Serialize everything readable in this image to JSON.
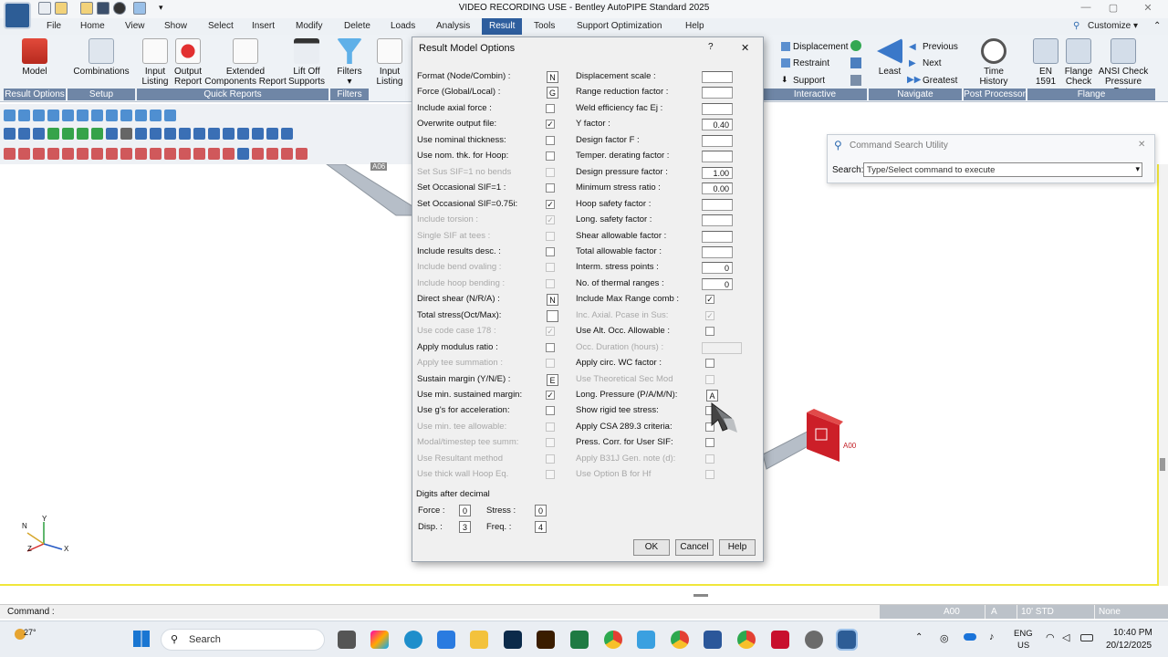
{
  "app": {
    "title": "VIDEO RECORDING USE - Bentley AutoPIPE Standard 2025",
    "customize": "Customize"
  },
  "menu": [
    "File",
    "Home",
    "View",
    "Show",
    "Select",
    "Insert",
    "Modify",
    "Delete",
    "Loads",
    "Analysis",
    "Result",
    "Tools",
    "Support Optimization",
    "Help"
  ],
  "ribbon": {
    "model": "Model",
    "combinations": "Combinations",
    "input_listing": "Input Listing",
    "output_report": "Output Report",
    "extended_report": "Extended Components Report",
    "lift_off": "Lift Off Supports",
    "filters": "Filters",
    "input_listing2": "Input Listing",
    "displacement": "Displacement",
    "restraint": "Restraint",
    "support": "Support",
    "least": "Least",
    "previous": "Previous",
    "next": "Next",
    "greatest": "Greatest",
    "time_history": "Time History",
    "en1591": "EN 1591",
    "flange_check": "Flange Check",
    "ansi_check": "ANSI Check Pressure Data",
    "groups": {
      "result_options": "Result Options",
      "setup": "Setup",
      "quick_reports": "Quick Reports",
      "filters": "Filters",
      "interactive": "Interactive",
      "navigate": "Navigate",
      "post_processor": "Post Processor",
      "flange": "Flange"
    }
  },
  "dialog": {
    "title": "Result Model Options",
    "help_glyph": "?",
    "close_glyph": "✕",
    "left_options": [
      {
        "label": "Format (Node/Combin) :",
        "ctrl": "sel",
        "value": "N",
        "disabled": false
      },
      {
        "label": "Force (Global/Local) :",
        "ctrl": "sel",
        "value": "G",
        "disabled": false
      },
      {
        "label": "Include axial force :",
        "ctrl": "chk",
        "value": "",
        "disabled": false
      },
      {
        "label": "Overwrite output file:",
        "ctrl": "chk",
        "value": "✓",
        "disabled": false
      },
      {
        "label": "Use nominal thickness:",
        "ctrl": "chk",
        "value": "",
        "disabled": false
      },
      {
        "label": "Use nom. thk. for Hoop:",
        "ctrl": "chk",
        "value": "",
        "disabled": false
      },
      {
        "label": "Set Sus SIF=1 no bends",
        "ctrl": "chk",
        "value": "",
        "disabled": true
      },
      {
        "label": "Set Occasional SIF=1 :",
        "ctrl": "chk",
        "value": "",
        "disabled": false
      },
      {
        "label": "Set Occasional SIF=0.75i:",
        "ctrl": "chk",
        "value": "✓",
        "disabled": false
      },
      {
        "label": "Include torsion :",
        "ctrl": "chk",
        "value": "✓",
        "disabled": true
      },
      {
        "label": "Single SIF at tees :",
        "ctrl": "chk",
        "value": "",
        "disabled": true
      },
      {
        "label": "Include results desc. :",
        "ctrl": "chk",
        "value": "",
        "disabled": false
      },
      {
        "label": "Include bend ovaling :",
        "ctrl": "chk",
        "value": "",
        "disabled": true
      },
      {
        "label": "Include hoop bending :",
        "ctrl": "chk",
        "value": "",
        "disabled": true
      },
      {
        "label": "Direct shear (N/R/A) :",
        "ctrl": "sel",
        "value": "N",
        "disabled": false
      },
      {
        "label": "Total stress(Oct/Max):",
        "ctrl": "sel",
        "value": "",
        "disabled": false
      },
      {
        "label": "Use code case 178 :",
        "ctrl": "chk",
        "value": "✓",
        "disabled": true
      },
      {
        "label": "Apply modulus ratio :",
        "ctrl": "chk",
        "value": "",
        "disabled": false
      },
      {
        "label": "Apply tee summation :",
        "ctrl": "chk",
        "value": "",
        "disabled": true
      },
      {
        "label": "Sustain margin (Y/N/E) :",
        "ctrl": "sel",
        "value": "E",
        "disabled": false
      },
      {
        "label": "Use min. sustained margin:",
        "ctrl": "chk",
        "value": "✓",
        "disabled": false
      },
      {
        "label": "Use g's for acceleration:",
        "ctrl": "chk",
        "value": "",
        "disabled": false
      },
      {
        "label": "Use min. tee allowable:",
        "ctrl": "chk",
        "value": "",
        "disabled": true
      },
      {
        "label": "Modal/timestep tee summ:",
        "ctrl": "chk",
        "value": "",
        "disabled": true
      },
      {
        "label": "Use Resultant method",
        "ctrl": "chk",
        "value": "",
        "disabled": true
      },
      {
        "label": "Use thick wall Hoop Eq.",
        "ctrl": "chk",
        "value": "",
        "disabled": true
      }
    ],
    "right_options": [
      {
        "label": "Displacement scale :",
        "ctrl": "txt",
        "value": "",
        "disabled": false
      },
      {
        "label": "Range reduction factor :",
        "ctrl": "txt",
        "value": "",
        "disabled": false
      },
      {
        "label": "Weld efficiency fac Ej :",
        "ctrl": "txt",
        "value": "",
        "disabled": false
      },
      {
        "label": "Y factor :",
        "ctrl": "txt",
        "value": "0.40",
        "disabled": false
      },
      {
        "label": "Design factor F :",
        "ctrl": "txt",
        "value": "",
        "disabled": false
      },
      {
        "label": "Temper. derating factor :",
        "ctrl": "txt",
        "value": "",
        "disabled": false
      },
      {
        "label": "Design pressure factor :",
        "ctrl": "txt",
        "value": "1.00",
        "disabled": false
      },
      {
        "label": "Minimum stress ratio :",
        "ctrl": "txt",
        "value": "0.00",
        "disabled": false
      },
      {
        "label": "Hoop safety factor :",
        "ctrl": "txt",
        "value": "",
        "disabled": false
      },
      {
        "label": "Long. safety factor :",
        "ctrl": "txt",
        "value": "",
        "disabled": false
      },
      {
        "label": "Shear allowable factor :",
        "ctrl": "txt",
        "value": "",
        "disabled": false
      },
      {
        "label": "Total allowable factor :",
        "ctrl": "txt",
        "value": "",
        "disabled": false
      },
      {
        "label": "Interm. stress points :",
        "ctrl": "txt",
        "value": "0",
        "disabled": false
      },
      {
        "label": "No. of thermal ranges :",
        "ctrl": "txt",
        "value": "0",
        "disabled": false
      },
      {
        "label": "Include Max Range comb :",
        "ctrl": "chk",
        "value": "✓",
        "disabled": false
      },
      {
        "label": "Inc. Axial. Pcase in Sus:",
        "ctrl": "chk",
        "value": "✓",
        "disabled": true
      },
      {
        "label": "Use Alt. Occ. Allowable :",
        "ctrl": "chk",
        "value": "",
        "disabled": false
      },
      {
        "label": "Occ. Duration (hours) :",
        "ctrl": "txt",
        "value": "",
        "disabled": true
      },
      {
        "label": "Apply circ. WC factor :",
        "ctrl": "chk",
        "value": "",
        "disabled": false
      },
      {
        "label": "Use Theoretical Sec Mod",
        "ctrl": "chk",
        "value": "",
        "disabled": true
      },
      {
        "label": "Long. Pressure (P/A/M/N):",
        "ctrl": "sel",
        "value": "A",
        "disabled": false
      },
      {
        "label": "Show rigid tee stress:",
        "ctrl": "chk",
        "value": "",
        "disabled": false
      },
      {
        "label": "Apply CSA 289.3 criteria:",
        "ctrl": "chk",
        "value": "",
        "disabled": false
      },
      {
        "label": "Press. Corr. for User SIF:",
        "ctrl": "chk",
        "value": "",
        "disabled": false
      },
      {
        "label": "Apply B31J Gen. note (d):",
        "ctrl": "chk",
        "value": "",
        "disabled": true
      },
      {
        "label": "Use Option B for Hf",
        "ctrl": "chk",
        "value": "",
        "disabled": true
      }
    ],
    "digits": {
      "heading": "Digits after decimal",
      "force_label": "Force :",
      "force_value": "0",
      "stress_label": "Stress :",
      "stress_value": "0",
      "disp_label": "Disp. :",
      "disp_value": "3",
      "freq_label": "Freq. :",
      "freq_value": "4"
    },
    "buttons": {
      "ok": "OK",
      "cancel": "Cancel",
      "help": "Help"
    }
  },
  "command_search": {
    "title": "Command Search Utility",
    "search_label": "Search:",
    "placeholder": "Type/Select command to execute"
  },
  "viewport": {
    "node_label": "A00",
    "axis_n": "N",
    "axis_y": "Y",
    "axis_x": "X",
    "axis_z": "Z",
    "top_label": "A06"
  },
  "status": {
    "command": "Command :",
    "node": "A00",
    "a": "A",
    "pipe": "10' STD",
    "none": "None"
  },
  "taskbar": {
    "temperature": "27°",
    "search": "Search",
    "lang_top": "ENG",
    "lang_bottom": "US",
    "time": "10:40 PM",
    "date": "20/12/2025"
  }
}
